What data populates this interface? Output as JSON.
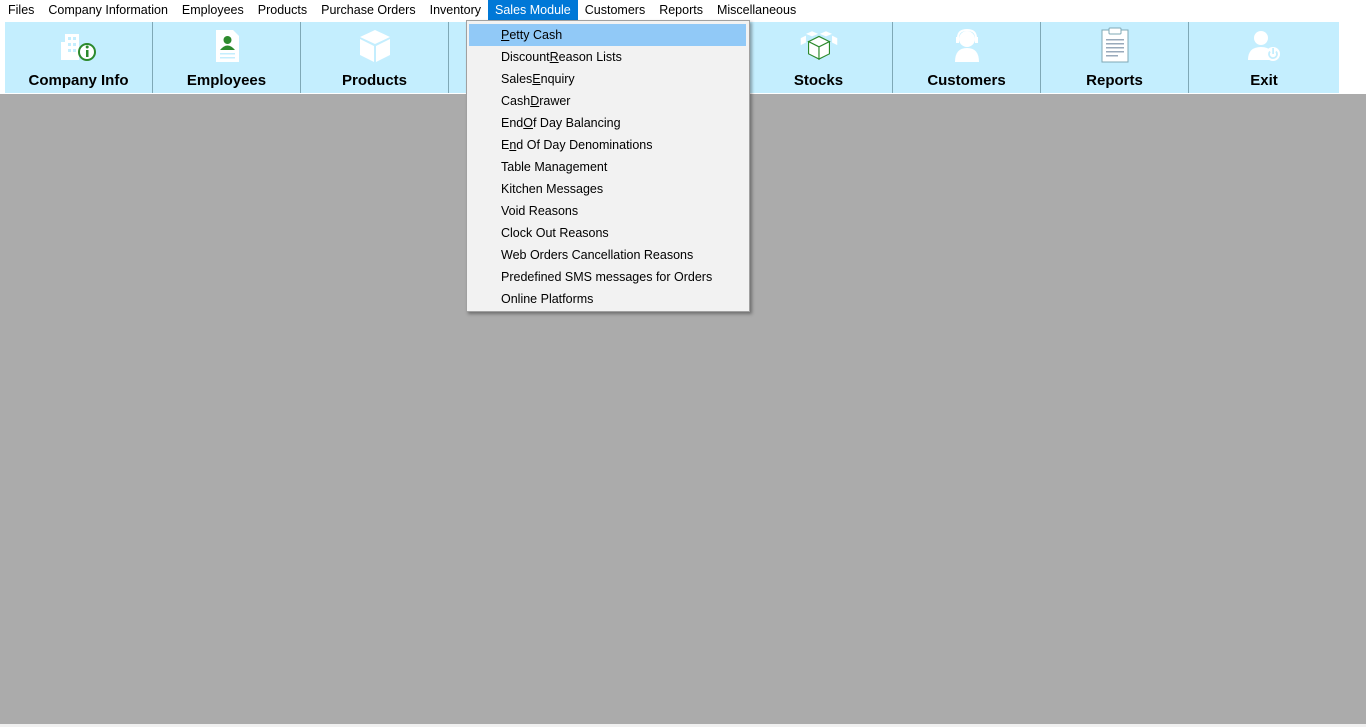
{
  "menubar": {
    "items": [
      "Files",
      "Company Information",
      "Employees",
      "Products",
      "Purchase Orders",
      "Inventory",
      "Sales Module",
      "Customers",
      "Reports",
      "Miscellaneous"
    ],
    "active": "Sales Module"
  },
  "toolbar": {
    "buttons": [
      {
        "label": "Company Info",
        "icon": "company-info-icon"
      },
      {
        "label": "Employees",
        "icon": "employees-icon"
      },
      {
        "label": "Products",
        "icon": "products-icon"
      },
      {
        "label": "",
        "icon": "hidden"
      },
      {
        "label": "",
        "icon": "hidden"
      },
      {
        "label": "Stocks",
        "icon": "stocks-icon"
      },
      {
        "label": "Customers",
        "icon": "customers-icon"
      },
      {
        "label": "Reports",
        "icon": "reports-icon"
      },
      {
        "label": "Exit",
        "icon": "exit-icon"
      }
    ]
  },
  "dropdown": {
    "items": [
      {
        "pre": "",
        "u": "P",
        "post": "etty Cash",
        "highlighted": true
      },
      {
        "pre": "Discount ",
        "u": "R",
        "post": "eason Lists"
      },
      {
        "pre": "Sales ",
        "u": "E",
        "post": "nquiry"
      },
      {
        "pre": "Cash ",
        "u": "D",
        "post": "rawer"
      },
      {
        "pre": "End ",
        "u": "O",
        "post": "f Day Balancing"
      },
      {
        "pre": "E",
        "u": "n",
        "post": "d Of Day Denominations"
      },
      {
        "pre": "Table Management",
        "u": "",
        "post": ""
      },
      {
        "pre": "Kitchen Messages",
        "u": "",
        "post": ""
      },
      {
        "pre": "Void Reasons",
        "u": "",
        "post": ""
      },
      {
        "pre": "Clock Out Reasons",
        "u": "",
        "post": ""
      },
      {
        "pre": "Web Orders Cancellation Reasons",
        "u": "",
        "post": ""
      },
      {
        "pre": "Predefined SMS messages for Orders",
        "u": "",
        "post": ""
      },
      {
        "pre": "Online Platforms",
        "u": "",
        "post": ""
      }
    ]
  },
  "colors": {
    "toolbar_bg": "#c4eefe",
    "workspace_bg": "#ababab",
    "menu_active": "#0078d7",
    "dropdown_highlight": "#91c9f7",
    "icon_white": "#ffffff",
    "icon_green": "#2d8a2d"
  }
}
